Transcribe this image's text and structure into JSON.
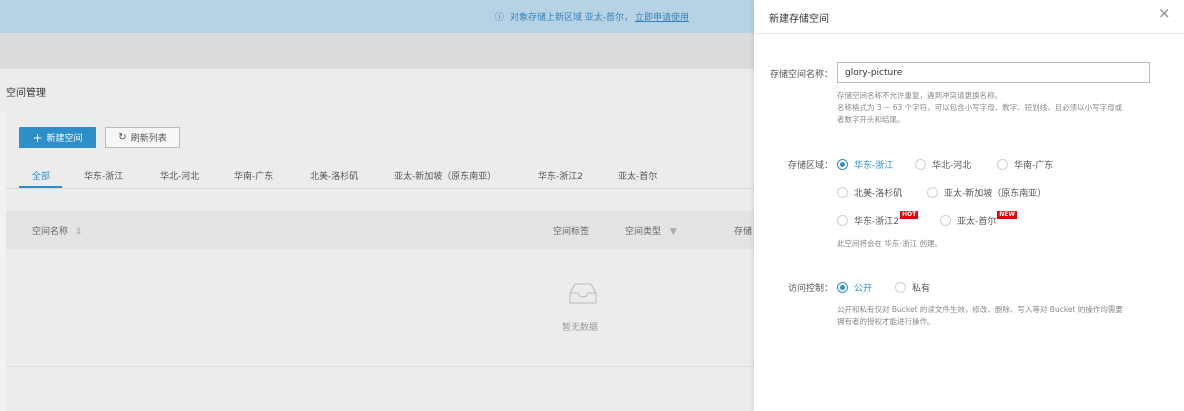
{
  "notice": {
    "text": "对象存储上新区域 亚太-首尔，",
    "link": "立即申请使用"
  },
  "page": {
    "section_title": "空间管理",
    "new_button": "新建空间",
    "refresh_button": "刷新列表",
    "tabs": [
      "全部",
      "华东-浙江",
      "华北-河北",
      "华南-广东",
      "北美-洛杉矶",
      "亚太-新加坡（原东南亚）",
      "华东-浙江2",
      "亚太-首尔"
    ],
    "active_tab": "全部",
    "columns": [
      "空间名称",
      "空间标签",
      "空间类型",
      "存储"
    ],
    "empty_text": "暂无数据"
  },
  "modal": {
    "title": "新建存储空间",
    "name_label": "存储空间名称：",
    "name_value": "glory-picture",
    "name_help": [
      "存储空间名称不允许重复，遇到冲突请更换名称。",
      "名称格式为 3 ~ 63 个字符，可以包含小写字母、数字、短划线，且必须以小写字母或",
      "者数字开头和结尾。"
    ],
    "region_label": "存储区域：",
    "regions": [
      "华东-浙江",
      "华北-河北",
      "华南-广东",
      "北美-洛杉矶",
      "亚太-新加坡（原东南亚）",
      "华东-浙江2",
      "亚太-首尔"
    ],
    "selected_region": "华东-浙江",
    "badge_hot": "HOT",
    "badge_new": "NEW",
    "region_help": "此空间将会在 华东-浙江 创建。",
    "access_label": "访问控制：",
    "access_options": [
      "公开",
      "私有"
    ],
    "selected_access": "公开",
    "access_help": [
      "公开和私有仅对 Bucket 的读文件生效，修改、删除、写入等对 Bucket 的操作均需要",
      "拥有者的授权才能进行操作。"
    ]
  },
  "icons": {
    "info": "info-circle-icon",
    "plus": "plus-icon",
    "refresh": "refresh-icon",
    "sort": "sort-icon",
    "filter": "filter-icon",
    "empty": "empty-inbox-icon",
    "close": "close-icon"
  },
  "colors": {
    "accent": "#2d8fc9",
    "notice_bg": "#b6d3e6",
    "badge": "#e8000b"
  }
}
